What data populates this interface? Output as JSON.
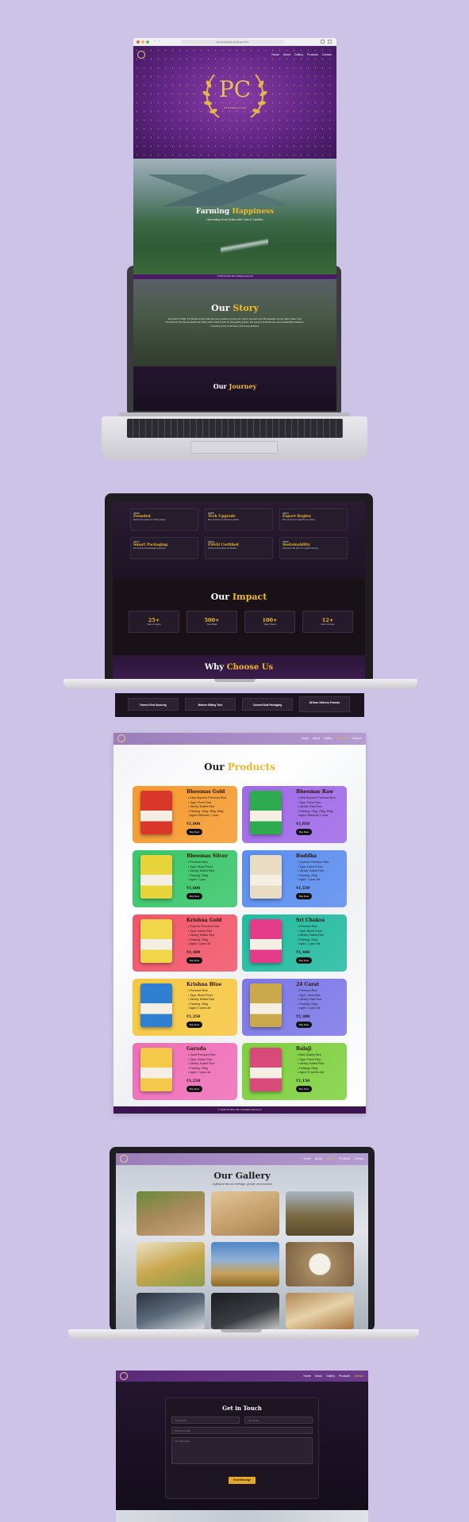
{
  "browser": {
    "url": "farmersbharati.com/index.html"
  },
  "nav": {
    "items": [
      "Home",
      "About",
      "Gallery",
      "Products",
      "Contact"
    ]
  },
  "hero": {
    "logo_text": "PC",
    "logo_sub": "PC FOODS PVT LTD"
  },
  "farming": {
    "title_a": "Farming",
    "title_b": "Happiness",
    "subtitle": "Harvesting Good Grains with Care & Tradition"
  },
  "copyright": "© 2025 PC Rice Mill. All Rights Reserved",
  "story": {
    "title_a": "Our",
    "title_b": "Story",
    "body": "Founded in 2002, PC Brothers Rice Mill has been delivering premium rice to Farmers and Wholesalers across Tamil Nadu. Our Promise lies the blend traditional milling with modern tech for top-quality grains. We support local farmers and sustainable practices, ensuring purity, freshness, and timely delivery."
  },
  "journey": {
    "title_a": "Our",
    "title_b": "Journey",
    "items": [
      {
        "year": "2002",
        "title": "Founded",
        "desc": "Started the quality rice milling legacy."
      },
      {
        "year": "2005",
        "title": "Tech Upgrade",
        "desc": "Best machines & machinery added."
      },
      {
        "year": "2013",
        "title": "Export Begins",
        "desc": "Rice exported to neighbor key states."
      },
      {
        "year": "2015",
        "title": "Smart Packaging",
        "desc": "Eco-friendly bulk packaging adopted."
      },
      {
        "year": "2018",
        "title": "FSSAI Certified",
        "desc": "Achieved food safety certification."
      },
      {
        "year": "2025",
        "title": "Sustainability",
        "desc": "Partnered with farms for organic farming."
      }
    ]
  },
  "impact": {
    "title_a": "Our",
    "title_b": "Impact",
    "stats": [
      {
        "value": "25+",
        "label": "Years of Legacy"
      },
      {
        "value": "500+",
        "label": "Tons Milled"
      },
      {
        "value": "100+",
        "label": "Happy Clients"
      },
      {
        "value": "12+",
        "label": "Farms Connect"
      }
    ]
  },
  "why": {
    "title_a": "Why",
    "title_b": "Choose Us",
    "items": [
      "Farmer-First Sourcing",
      "Modern Milling Tech",
      "Custom Bulk Packaging",
      "48 Hour Delivery Promise"
    ]
  },
  "products": {
    "title_a": "Our",
    "title_b": "Products",
    "buy_label": "Buy Now",
    "items": [
      {
        "name": "Bheemas Gold",
        "bg": "#f59a2f",
        "bag": "#d8372a",
        "specs": [
          "Ultra Superior Premium Rice",
          "Type: Ponni Rice",
          "Variety: Boiled Rice",
          "Packing: 10kg, 25kg, 50kg",
          "Aged: Minimum 1 year"
        ],
        "price": "₹1,800"
      },
      {
        "name": "Bheemas Raw",
        "bg": "#a06ae8",
        "bag": "#2eab4e",
        "specs": [
          "Ultra Superior Premium Rice",
          "Type: Ponni Rice",
          "Variety: Raw Rice",
          "Packing: 10kg, 25kg, 50kg",
          "Aged: Minimum 1 year"
        ],
        "price": "₹1,850"
      },
      {
        "name": "Bheemas Silver",
        "bg": "#39c66a",
        "bag": "#e7d43a",
        "specs": [
          "Premium Rice",
          "Type: Bhavi Ponni",
          "Variety: Boiled Rice",
          "Packing: 25kg",
          "Aged: 1 year"
        ],
        "price": "₹1,600"
      },
      {
        "name": "Buddha",
        "bg": "#5c8ef0",
        "bag": "#e9dcc3",
        "specs": [
          "Superior Premium Rice",
          "Type: Delux Ponni",
          "Variety: Boiled Rice",
          "Packing: 25kg",
          "Aged: 1 year old"
        ],
        "price": "₹1,550"
      },
      {
        "name": "Krishna Gold",
        "bg": "#f2566a",
        "bag": "#f2d64a",
        "specs": [
          "Superior Premium Rice",
          "Type: Kolam Rice",
          "Variety: Boiled Rice",
          "Packing: 25kg",
          "Aged: 1 year old"
        ],
        "price": "₹1,480"
      },
      {
        "name": "Sri Chakra",
        "bg": "#23bca0",
        "bag": "#e43b8a",
        "specs": [
          "Premium Rice",
          "Type: Bhavi Ponni",
          "Variety: Boiled Rice",
          "Packing: 25kg",
          "Aged: 1 year old"
        ],
        "price": "₹1,400"
      },
      {
        "name": "Krishna Blue",
        "bg": "#f7c842",
        "bag": "#2f7fd3",
        "specs": [
          "Premium Rice",
          "Type: Bhavi Ponni",
          "Variety: Boiled Rice",
          "Packing: 25kg",
          "Aged: 1 year old"
        ],
        "price": "₹1,350"
      },
      {
        "name": "24 Carat",
        "bg": "#7c78e8",
        "bag": "#c9a94a",
        "specs": [
          "Premium Rice",
          "Type: Jeera Rice",
          "Variety: Raw Rice",
          "Packing: 25kg",
          "Aged: 1 year old"
        ],
        "price": "₹1,300"
      },
      {
        "name": "Garuda",
        "bg": "#f06fb8",
        "bag": "#f4c94a",
        "specs": [
          "Good Premium Rice",
          "Type: Kolam Rice",
          "Variety: Boiled Rice",
          "Packing: 25kg",
          "Aged: 1 year old"
        ],
        "price": "₹1,250"
      },
      {
        "name": "Balaji",
        "bg": "#7fd13f",
        "bag": "#d84a7a",
        "specs": [
          "Best Quality Rice",
          "Type: Ponni Rice",
          "Variety: Boiled Rice",
          "Packing: 25kg",
          "Aged: 6 months old"
        ],
        "price": "₹1,150"
      }
    ]
  },
  "gallery": {
    "title_a": "Our",
    "title_b": "Gallery",
    "subtitle": "A glimpse into our heritage, people, and process"
  },
  "contact": {
    "title": "Get in Touch",
    "name_ph": "Your Name",
    "email_ph": "Your Email",
    "phone_ph": "Phone Number",
    "message_ph": "Your Message",
    "send_label": "Send Message"
  }
}
